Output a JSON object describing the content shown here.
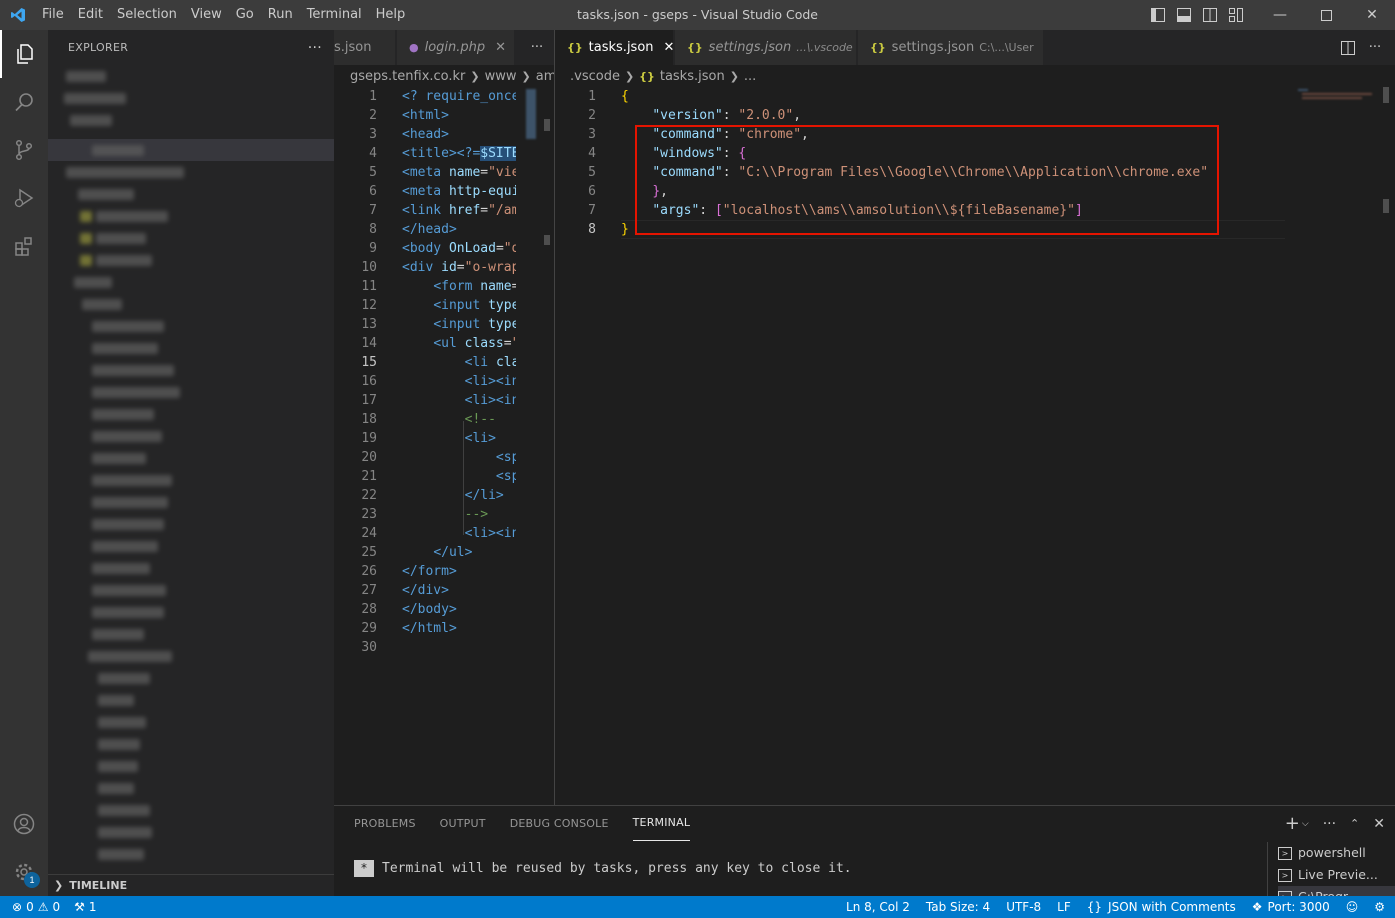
{
  "titlebar": {
    "menu": [
      "File",
      "Edit",
      "Selection",
      "View",
      "Go",
      "Run",
      "Terminal",
      "Help"
    ],
    "title": "tasks.json - gseps - Visual Studio Code"
  },
  "sidebar": {
    "header": "EXPLORER",
    "more": "···",
    "timeline": "TIMELINE"
  },
  "left_group": {
    "tabs": [
      {
        "label": "s.json",
        "icon": "json-icon"
      },
      {
        "label": "login.php",
        "icon": "php-elephant-icon"
      }
    ],
    "breadcrumbs": [
      "gseps.tenfix.co.kr",
      "www",
      "ams",
      "a"
    ],
    "line_numbers": [
      "1",
      "2",
      "3",
      "4",
      "5",
      "6",
      "7",
      "8",
      "9",
      "10",
      "11",
      "12",
      "13",
      "14",
      "15",
      "16",
      "17",
      "18",
      "19",
      "20",
      "21",
      "22",
      "23",
      "24",
      "25",
      "26",
      "27",
      "28",
      "29",
      "30"
    ],
    "current_line": "15",
    "lines": [
      [
        {
          "c": "php",
          "t": "<? require_once"
        }
      ],
      [
        {
          "c": "tag",
          "t": "<html>"
        }
      ],
      [
        {
          "c": "tag",
          "t": "<head>"
        }
      ],
      [
        {
          "c": "tag",
          "t": "<title>"
        },
        {
          "c": "php",
          "t": "<?="
        },
        {
          "c": "sel",
          "t": "$SITE"
        }
      ],
      [
        {
          "c": "tag",
          "t": "<meta "
        },
        {
          "c": "attr",
          "t": "name"
        },
        {
          "c": "txt",
          "t": "="
        },
        {
          "c": "str",
          "t": "\"vie"
        }
      ],
      [
        {
          "c": "tag",
          "t": "<meta "
        },
        {
          "c": "attr",
          "t": "http-equi"
        }
      ],
      [
        {
          "c": "tag",
          "t": "<link "
        },
        {
          "c": "attr",
          "t": "href"
        },
        {
          "c": "txt",
          "t": "="
        },
        {
          "c": "str",
          "t": "\"/am"
        }
      ],
      [
        {
          "c": "tag",
          "t": "</head>"
        }
      ],
      [
        {
          "c": "tag",
          "t": "<body "
        },
        {
          "c": "attr",
          "t": "OnLoad"
        },
        {
          "c": "txt",
          "t": "="
        },
        {
          "c": "str",
          "t": "\"d"
        }
      ],
      [
        {
          "c": "tag",
          "t": "<div "
        },
        {
          "c": "attr",
          "t": "id"
        },
        {
          "c": "txt",
          "t": "="
        },
        {
          "c": "str",
          "t": "\"o-wrap"
        }
      ],
      [
        {
          "c": "txt",
          "t": "    "
        },
        {
          "c": "tag",
          "t": "<form "
        },
        {
          "c": "attr",
          "t": "name"
        },
        {
          "c": "txt",
          "t": "="
        }
      ],
      [
        {
          "c": "txt",
          "t": "    "
        },
        {
          "c": "tag",
          "t": "<input "
        },
        {
          "c": "attr",
          "t": "type"
        }
      ],
      [
        {
          "c": "txt",
          "t": "    "
        },
        {
          "c": "tag",
          "t": "<input "
        },
        {
          "c": "attr",
          "t": "type"
        }
      ],
      [
        {
          "c": "txt",
          "t": "    "
        },
        {
          "c": "tag",
          "t": "<ul "
        },
        {
          "c": "attr",
          "t": "class"
        },
        {
          "c": "txt",
          "t": "="
        },
        {
          "c": "str",
          "t": "\""
        }
      ],
      [
        {
          "c": "txt",
          "t": "        "
        },
        {
          "c": "tag",
          "t": "<li "
        },
        {
          "c": "attr",
          "t": "cla"
        }
      ],
      [
        {
          "c": "txt",
          "t": "        "
        },
        {
          "c": "tag",
          "t": "<li><in"
        }
      ],
      [
        {
          "c": "txt",
          "t": "        "
        },
        {
          "c": "tag",
          "t": "<li><in"
        }
      ],
      [
        {
          "c": "txt",
          "t": "        "
        },
        {
          "c": "cm",
          "t": "<!--"
        }
      ],
      [
        {
          "c": "txt",
          "t": "        "
        },
        {
          "c": "tag",
          "t": "<li>"
        }
      ],
      [
        {
          "c": "txt",
          "t": "            "
        },
        {
          "c": "tag",
          "t": "<sp"
        }
      ],
      [
        {
          "c": "txt",
          "t": "            "
        },
        {
          "c": "tag",
          "t": "<sp"
        }
      ],
      [
        {
          "c": "txt",
          "t": "        "
        },
        {
          "c": "tag",
          "t": "</li>"
        }
      ],
      [
        {
          "c": "txt",
          "t": "        "
        },
        {
          "c": "cm",
          "t": "-->"
        }
      ],
      [
        {
          "c": "txt",
          "t": "        "
        },
        {
          "c": "tag",
          "t": "<li><in"
        }
      ],
      [
        {
          "c": "txt",
          "t": "    "
        },
        {
          "c": "tag",
          "t": "</ul>"
        }
      ],
      [
        {
          "c": "tag",
          "t": "</form>"
        }
      ],
      [
        {
          "c": "tag",
          "t": "</div>"
        }
      ],
      [
        {
          "c": "tag",
          "t": "</body>"
        }
      ],
      [
        {
          "c": "tag",
          "t": "</html>"
        }
      ],
      []
    ]
  },
  "right_group": {
    "tabs": [
      {
        "label": "tasks.json",
        "desc": "",
        "icon": "json-braces-icon",
        "active": true,
        "close": "✕"
      },
      {
        "label": "settings.json",
        "desc": "...\\.vscode",
        "icon": "json-braces-icon",
        "active": false
      },
      {
        "label": "settings.json",
        "desc": "C:\\...\\User",
        "icon": "json-braces-icon",
        "active": false
      }
    ],
    "breadcrumbs": [
      ".vscode",
      "tasks.json",
      "..."
    ],
    "line_numbers": [
      "1",
      "2",
      "3",
      "4",
      "5",
      "6",
      "7",
      "8"
    ],
    "current_line": "8",
    "lines": [
      [
        {
          "c": "br1",
          "t": "{"
        }
      ],
      [
        {
          "c": "txt",
          "t": "    "
        },
        {
          "c": "key",
          "t": "\"version\""
        },
        {
          "c": "txt",
          "t": ": "
        },
        {
          "c": "str",
          "t": "\"2.0.0\""
        },
        {
          "c": "txt",
          "t": ","
        }
      ],
      [
        {
          "c": "txt",
          "t": "    "
        },
        {
          "c": "key",
          "t": "\"command\""
        },
        {
          "c": "txt",
          "t": ": "
        },
        {
          "c": "str",
          "t": "\"chrome\""
        },
        {
          "c": "txt",
          "t": ","
        }
      ],
      [
        {
          "c": "txt",
          "t": "    "
        },
        {
          "c": "key",
          "t": "\"windows\""
        },
        {
          "c": "txt",
          "t": ": "
        },
        {
          "c": "br2",
          "t": "{"
        }
      ],
      [
        {
          "c": "txt",
          "t": "    "
        },
        {
          "c": "key",
          "t": "\"command\""
        },
        {
          "c": "txt",
          "t": ": "
        },
        {
          "c": "str",
          "t": "\"C:\\\\Program Files\\\\Google\\\\Chrome\\\\Application\\\\chrome.exe\""
        }
      ],
      [
        {
          "c": "txt",
          "t": "    "
        },
        {
          "c": "br2",
          "t": "}"
        },
        {
          "c": "txt",
          "t": ","
        }
      ],
      [
        {
          "c": "txt",
          "t": "    "
        },
        {
          "c": "key",
          "t": "\"args\""
        },
        {
          "c": "txt",
          "t": ": "
        },
        {
          "c": "br2",
          "t": "["
        },
        {
          "c": "str",
          "t": "\"localhost\\\\ams\\\\amsolution\\\\${fileBasename}\""
        },
        {
          "c": "br2",
          "t": "]"
        }
      ],
      [
        {
          "c": "br1",
          "t": "}"
        }
      ]
    ],
    "highlight_color": "#e51400"
  },
  "panel": {
    "tabs": [
      "PROBLEMS",
      "OUTPUT",
      "DEBUG CONSOLE",
      "TERMINAL"
    ],
    "active_tab": "TERMINAL",
    "star": "*",
    "message": "Terminal will be reused by tasks, press any key to close it.",
    "terminals": [
      "powershell",
      "Live Previe...",
      "C:\\Progr..."
    ]
  },
  "statusbar": {
    "errors": "0",
    "warnings": "0",
    "remote": "1",
    "position": "Ln 8, Col 2",
    "tab_size": "Tab Size: 4",
    "encoding": "UTF-8",
    "eol": "LF",
    "language": "JSON with Comments",
    "port": "Port: 3000",
    "accent": "#007acc"
  },
  "settings_badge": "1"
}
